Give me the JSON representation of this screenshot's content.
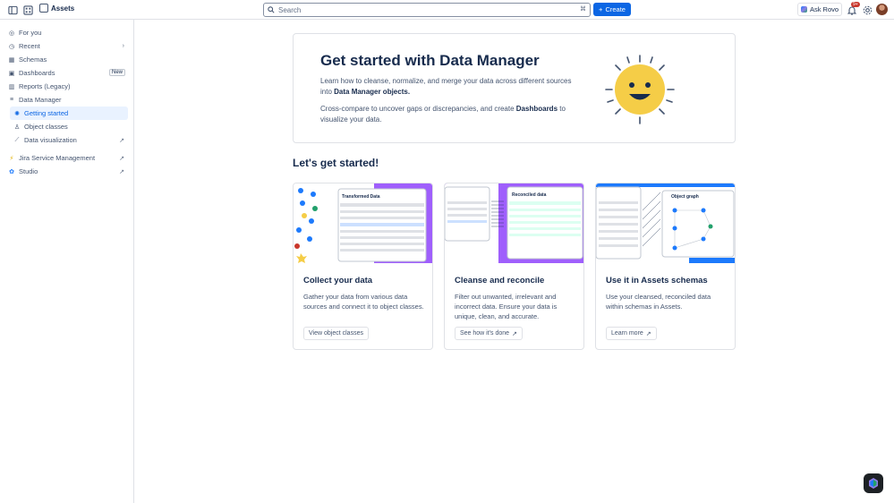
{
  "topbar": {
    "app_name": "Assets",
    "search_placeholder": "Search",
    "create_label": "Create",
    "rovo_label": "Ask Rovo",
    "notification_count": "9+"
  },
  "sidebar": {
    "items": [
      {
        "label": "For you",
        "icon": "person-icon"
      },
      {
        "label": "Recent",
        "icon": "clock-icon"
      },
      {
        "label": "Schemas",
        "icon": "grid-icon"
      },
      {
        "label": "Dashboards",
        "icon": "dashboard-icon",
        "badge": "New"
      },
      {
        "label": "Reports (Legacy)",
        "icon": "chart-icon"
      },
      {
        "label": "Data Manager",
        "icon": "menu-icon"
      },
      {
        "label": "Getting started",
        "icon": "sun-icon"
      },
      {
        "label": "Object classes",
        "icon": "person-icon"
      },
      {
        "label": "Data visualization",
        "icon": "chart-icon"
      },
      {
        "label": "Jira Service Management",
        "icon": "jsm-icon"
      },
      {
        "label": "Studio",
        "icon": "studio-icon"
      }
    ]
  },
  "hero": {
    "title": "Get started with Data Manager",
    "p1_pre": "Learn how to cleanse, normalize, and merge your data across different sources into ",
    "p1_bold": "Data Manager objects.",
    "p2_pre": "Cross-compare to uncover gaps or discrepancies, and create ",
    "p2_bold": "Dashboards",
    "p2_post": " to visualize your data."
  },
  "section_title": "Let's get started!",
  "cards": [
    {
      "title": "Collect your data",
      "desc": "Gather your data from various data sources and connect it to object classes.",
      "button": "View object classes",
      "thumb_label": "Transformed Data"
    },
    {
      "title": "Cleanse and reconcile",
      "desc": "Filter out unwanted, irrelevant and incorrect data. Ensure your data is unique, clean, and accurate.",
      "button": "See how it's done",
      "thumb_label": "Reconciled data"
    },
    {
      "title": "Use it in Assets schemas",
      "desc": "Use your cleansed, reconciled data within schemas in Assets.",
      "button": "Learn more",
      "thumb_label": "Object graph"
    }
  ],
  "colors": {
    "brand": "#0c66e4",
    "accent_purple": "#9f5ffc",
    "sun": "#f5cd47"
  }
}
